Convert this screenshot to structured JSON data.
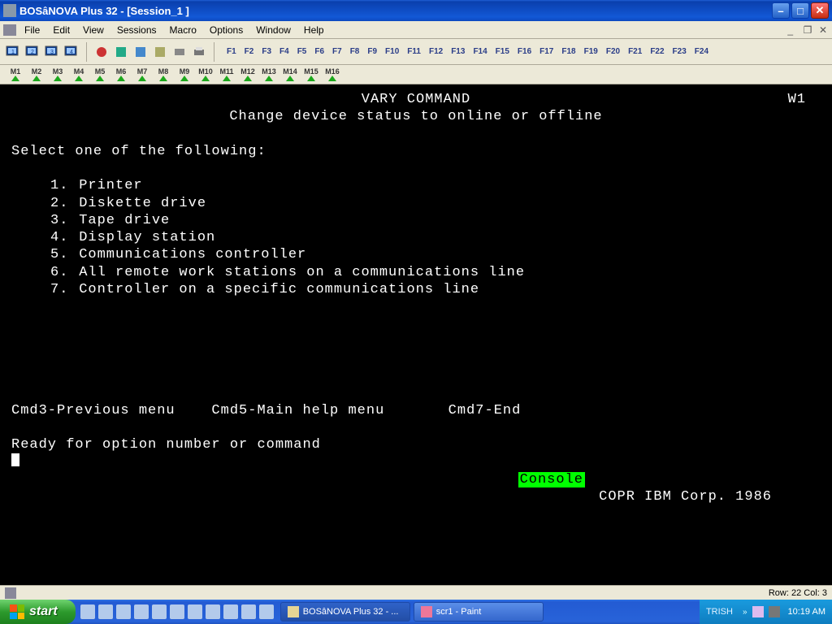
{
  "window": {
    "title": "BOSâNOVA Plus 32 - [Session_1 ]"
  },
  "menu": {
    "items": [
      "File",
      "Edit",
      "View",
      "Sessions",
      "Macro",
      "Options",
      "Window",
      "Help"
    ]
  },
  "fkeys": [
    "F1",
    "F2",
    "F3",
    "F4",
    "F5",
    "F6",
    "F7",
    "F8",
    "F9",
    "F10",
    "F11",
    "F12",
    "F13",
    "F14",
    "F15",
    "F16",
    "F17",
    "F18",
    "F19",
    "F20",
    "F21",
    "F22",
    "F23",
    "F24"
  ],
  "session_tabs": [
    "M1",
    "M2",
    "M3",
    "M4",
    "M5",
    "M6",
    "M7",
    "M8",
    "M9",
    "M10",
    "M11",
    "M12",
    "M13",
    "M14",
    "M15",
    "M16"
  ],
  "terminal": {
    "title": "VARY COMMAND",
    "corner": "W1",
    "subtitle": "Change device status to online or offline",
    "prompt": "Select one of the following:",
    "options": [
      {
        "n": "1.",
        "t": "Printer"
      },
      {
        "n": "2.",
        "t": "Diskette drive"
      },
      {
        "n": "3.",
        "t": "Tape drive"
      },
      {
        "n": "4.",
        "t": "Display station"
      },
      {
        "n": "5.",
        "t": "Communications controller"
      },
      {
        "n": "6.",
        "t": "All remote work stations on a communications line"
      },
      {
        "n": "7.",
        "t": "Controller on a specific communications line"
      }
    ],
    "cmds": "Cmd3-Previous menu    Cmd5-Main help menu       Cmd7-End",
    "ready": "Ready for option number or command",
    "console": "Console",
    "copr": "COPR IBM Corp. 1986"
  },
  "status": {
    "pos": "Row: 22  Col: 3"
  },
  "taskbar": {
    "start": "start",
    "buttons": [
      {
        "label": "BOSâNOVA Plus 32 - ...",
        "active": true
      },
      {
        "label": "scr1 - Paint",
        "active": false
      }
    ],
    "user": "TRISH",
    "clock": "10:19 AM"
  }
}
